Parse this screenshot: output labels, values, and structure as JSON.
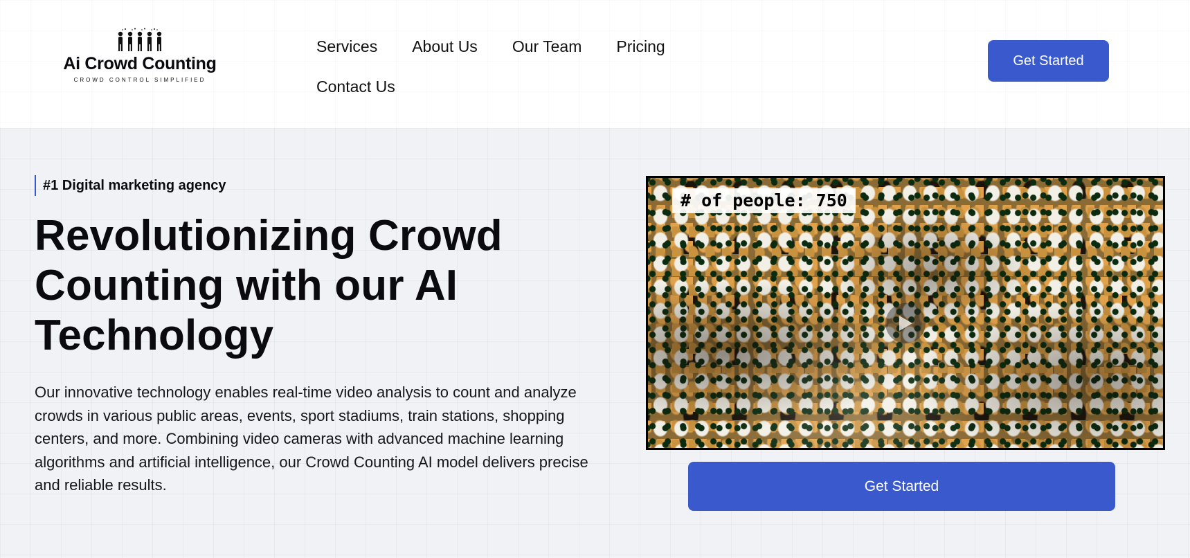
{
  "brand": {
    "name": "Ai Crowd Counting",
    "tagline": "CROWD CONTROL SIMPLIFIED",
    "accent_color": "#3a59cc"
  },
  "nav": {
    "items": [
      {
        "label": "Services"
      },
      {
        "label": "About Us"
      },
      {
        "label": "Our Team"
      },
      {
        "label": "Pricing"
      },
      {
        "label": "Contact Us"
      }
    ],
    "cta_label": "Get Started"
  },
  "hero": {
    "eyebrow": "#1 Digital marketing agency",
    "headline": "Revolutionizing Crowd Counting with our AI Technology",
    "description": "Our innovative technology enables real-time video analysis to count and analyze crowds in various public areas, events, sport stadiums, train stations, shopping centers, and more. Combining video cameras with advanced machine learning algorithms and artificial intelligence, our Crowd Counting AI model delivers precise and reliable results.",
    "video": {
      "overlay_text": "# of people: 750",
      "icon": "play-icon"
    },
    "cta_label": "Get Started"
  }
}
